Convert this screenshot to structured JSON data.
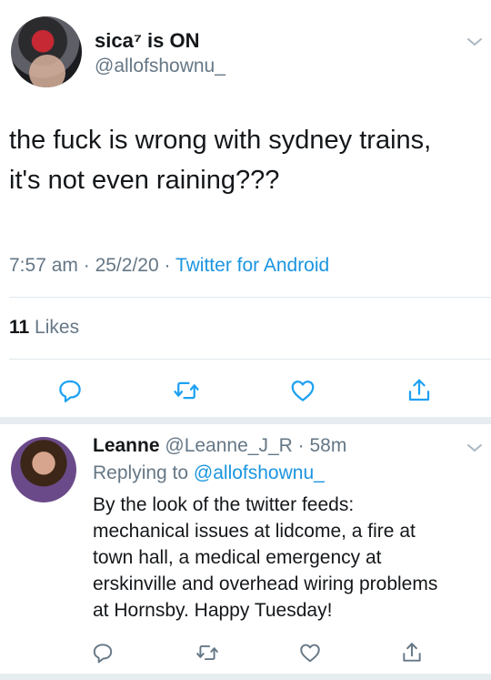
{
  "tweet": {
    "display_name": "sica⁷ is ON",
    "handle": "@allofshownu_",
    "text_line1": "the fuck is wrong with sydney trains,",
    "text_line2": "it's not even raining???",
    "time": "7:57 am",
    "dot1": "·",
    "date": "25/2/20",
    "dot2": "·",
    "source": "Twitter for Android",
    "likes_count": "11",
    "likes_label": "Likes",
    "icons": [
      "reply-icon",
      "retweet-icon",
      "like-icon",
      "share-icon",
      "chevron-down-icon"
    ]
  },
  "reply_tweet": {
    "display_name": "Leanne",
    "handle": "@Leanne_J_R",
    "dot": "·",
    "time": "58m",
    "replying_prefix": "Replying to",
    "replying_to": "@allofshownu_",
    "text_lines": [
      "By the look of the twitter feeds:",
      "mechanical issues at lidcome, a fire at",
      "town hall, a medical emergency at",
      "erskinville and overhead wiring problems",
      "at Hornsby. Happy Tuesday!"
    ],
    "icons": [
      "reply-icon",
      "retweet-icon",
      "like-icon",
      "share-icon",
      "chevron-down-icon"
    ]
  },
  "colors": {
    "text": "#14171a",
    "secondary": "#657786",
    "link": "#1b95e0",
    "divider": "#e1e8ed",
    "separator": "#e6ecf0"
  }
}
